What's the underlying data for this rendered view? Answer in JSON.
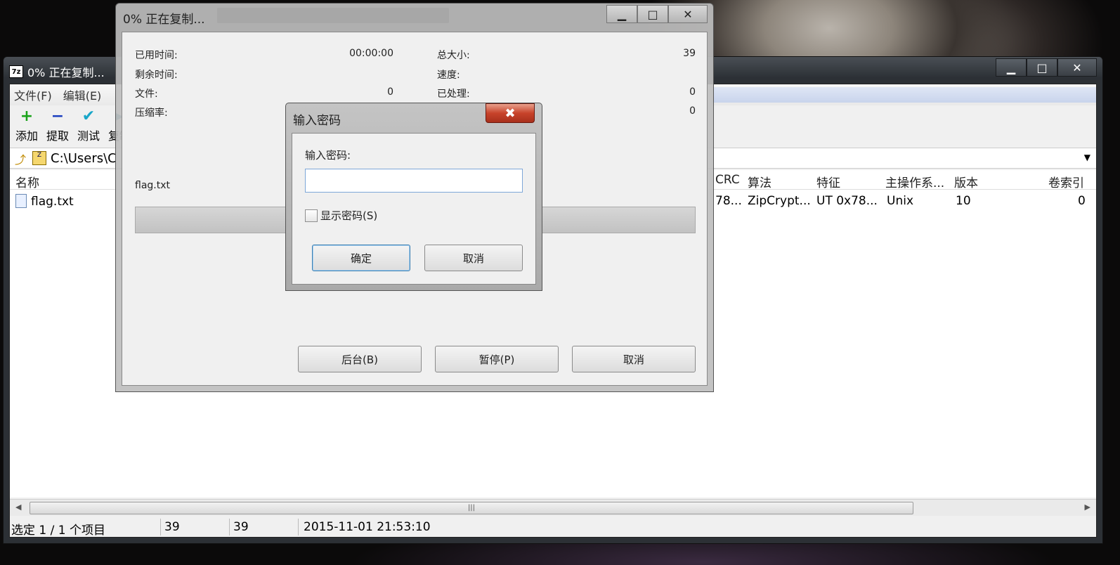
{
  "main_window": {
    "title": "0% 正在复制...",
    "app_icon": "7z",
    "menu": [
      "文件(F)",
      "编辑(E)"
    ],
    "toolbar": [
      {
        "label": "添加",
        "icon": "add-icon"
      },
      {
        "label": "提取",
        "icon": "extract-icon"
      },
      {
        "label": "测试",
        "icon": "test-icon"
      },
      {
        "label": "复制",
        "icon": "copy-icon"
      }
    ],
    "address": "C:\\Users\\C",
    "columns": {
      "name": "名称",
      "crc": "CRC",
      "method": "算法",
      "characteristics": "特征",
      "host_os": "主操作系...",
      "version": "版本",
      "volume_index": "卷索引"
    },
    "row": {
      "name": "flag.txt",
      "crc": "78...",
      "method": "ZipCrypt...",
      "characteristics": "UT 0x78...",
      "host_os": "Unix",
      "version": "10",
      "volume_index": "0"
    },
    "status": {
      "selection": "选定 1 / 1 个项目",
      "size": "39",
      "packed": "39",
      "modified": "2015-11-01 21:53:10"
    }
  },
  "progress_window": {
    "title": "0% 正在复制...",
    "elapsed_label": "已用时间:",
    "elapsed_value": "00:00:00",
    "remaining_label": "剩余时间:",
    "files_label": "文件:",
    "files_value": "0",
    "ratio_label": "压缩率:",
    "total_label": "总大小:",
    "total_value": "39",
    "speed_label": "速度:",
    "processed_label": "已处理:",
    "processed_value": "0",
    "packed_value": "0",
    "current_file": "flag.txt",
    "progress_fraction": 0,
    "buttons": {
      "background": "后台(B)",
      "pause": "暂停(P)",
      "cancel": "取消"
    }
  },
  "password_dialog": {
    "title": "输入密码",
    "label": "输入密码:",
    "password_value": "",
    "show_password": "显示密码(S)",
    "ok": "确定",
    "cancel": "取消"
  }
}
